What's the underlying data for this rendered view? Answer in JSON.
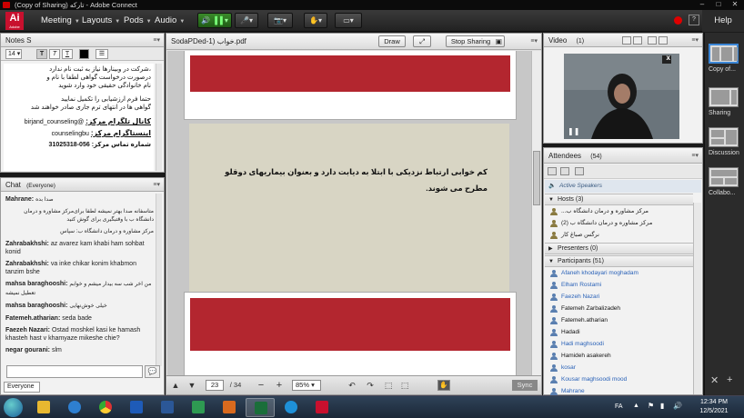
{
  "window": {
    "title": "(Copy of Sharing) تارکه - Adobe Connect"
  },
  "menubar": {
    "logo": "Ai",
    "logo_sub": "Adobe",
    "items": [
      "Meeting",
      "Layouts",
      "Pods",
      "Audio"
    ],
    "help": "Help",
    "status_color": "#e00000"
  },
  "notes": {
    "title": "Notes S",
    "font_size": "14",
    "lines": [
      "،شرکت در وبینارها نیاز به ثبت نام ندارد",
      "درصورت درخواست گواهی لطفا با نام و",
      "نام خانوادگی حقیقی خود وارد شوید",
      "",
      "حتما فرم ارزشیابی را تکمیل نمایید",
      "گواهی ها در انتهای ترم جاری صادر خواهند شد"
    ],
    "contact_1_label": "کانال تلگرام مرکز:",
    "contact_1_value": "@birjand_counseling",
    "contact_2_label": "اینستاگرام مرکز:",
    "contact_2_value": "counselingbu",
    "contact_3_label": "شماره تماس مرکز:",
    "contact_3_value": "056-31025318"
  },
  "chat": {
    "title": "Chat",
    "audience": "(Everyone)",
    "messages": [
      {
        "name": "Mahrane:",
        "text": "صدا بده"
      },
      {
        "name": "",
        "text": "متاسفانه صدا بهتر نمیشه لطفا برای‌مرکز مشاوره و درمان دانشگاه ب با وقتبگیری برای گوش کنید"
      },
      {
        "name": "",
        "text": "مرکز مشاوره و درمان دانشگاه ب: سپاس"
      },
      {
        "name": "Zahrabakhshi:",
        "text": "az avarez kam khabi ham sohbat konid"
      },
      {
        "name": "Zahrabakhshi:",
        "text": "va inke chikar konim khabmon tanzim bshe"
      },
      {
        "name": "mahsa baraghooshi:",
        "text": "من اخر شب سه بیدار میشم و خوابم تعطیل نمیشه"
      },
      {
        "name": "mahsa baraghooshi:",
        "text": "خیلی خوش‌نهایی"
      },
      {
        "name": "Fatemeh.atharian:",
        "text": "seda bade"
      },
      {
        "name": "Faezeh Nazari:",
        "text": "Ostad moshkel kasi ke hamash khasteh hast v khamyaze mikeshe chie?"
      },
      {
        "name": "negar gourani:",
        "text": "slm"
      }
    ],
    "send_to": "Everyone"
  },
  "share": {
    "title": "SodaPDed-1) خواب.pdf",
    "draw_label": "Draw",
    "stop_label": "Stop Sharing",
    "slide_text": "کم خوابی ارتباط نزدیکی با ابتلا به دیابت دارد و بعنوان بیماریهای دوقلو مطرح می شوند.",
    "page": "23",
    "total": "/ 34",
    "zoom": "85%",
    "sync": "Sync"
  },
  "video": {
    "title": "Video",
    "count": "(1)",
    "pause": "❚❚",
    "close": "x"
  },
  "attendees": {
    "title": "Attendees",
    "count": "(54)",
    "active_speakers": "Active Speakers",
    "hosts_label": "Hosts",
    "hosts_count": "(3)",
    "hosts": [
      "مرکز مشاوره و درمان دانشگاه ب...",
      "مرکز مشاوره و درمان دانشگاه ب (2)",
      "نرگس صباغ کار"
    ],
    "presenters_label": "Presenters",
    "presenters_count": "(0)",
    "participants_label": "Participants",
    "participants_count": "(51)",
    "participants": [
      {
        "name": "Afaneh khodayari moghadam",
        "color": "#2a62b8"
      },
      {
        "name": "Elham Rostami",
        "color": "#2a62b8"
      },
      {
        "name": "Faezeh Nazari",
        "color": "#2a62b8"
      },
      {
        "name": "Fatemeh Zarbalizadeh",
        "color": "#111111"
      },
      {
        "name": "Fatemeh.atharian",
        "color": "#111111"
      },
      {
        "name": "Hadadi",
        "color": "#111111"
      },
      {
        "name": "Hadi maghsoodi",
        "color": "#2a62b8"
      },
      {
        "name": "Hamideh asakereh",
        "color": "#111111"
      },
      {
        "name": "kosar",
        "color": "#2a62b8"
      },
      {
        "name": "Kousar maghsoodi mood",
        "color": "#2a62b8"
      },
      {
        "name": "Mahrane",
        "color": "#2a62b8"
      }
    ]
  },
  "layouts": {
    "items": [
      "Copy of...",
      "Sharing",
      "Discussion",
      "Collabo..."
    ]
  },
  "taskbar": {
    "lang": "FA",
    "time": "12:34 PM",
    "date": "12/5/2021"
  }
}
